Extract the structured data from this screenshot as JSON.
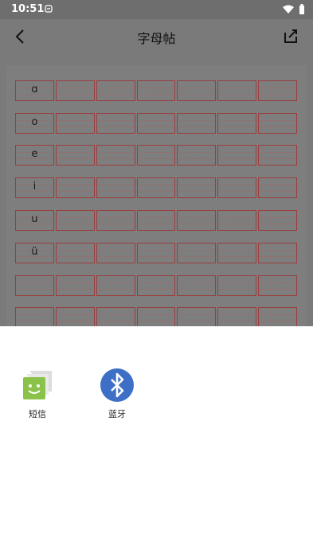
{
  "status_bar": {
    "time": "10:51"
  },
  "app_bar": {
    "title": "字母帖"
  },
  "sheet": {
    "letters": [
      "ɑ",
      "o",
      "e",
      "i",
      "u",
      "ü",
      "",
      ""
    ]
  },
  "share_sheet": {
    "items": [
      {
        "label": "短信",
        "icon": "sms-icon"
      },
      {
        "label": "蓝牙",
        "icon": "bluetooth-icon"
      }
    ]
  },
  "colors": {
    "overlay": "#7a7a7a",
    "grid_red": "#9b3d3d",
    "bluetooth_blue": "#3d6fc6",
    "sms_green": "#8bc34a"
  }
}
